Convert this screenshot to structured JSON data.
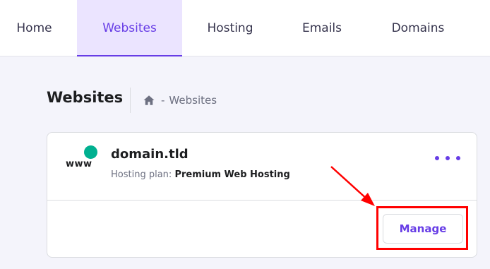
{
  "nav": {
    "tabs": [
      {
        "label": "Home",
        "active": false
      },
      {
        "label": "Websites",
        "active": true
      },
      {
        "label": "Hosting",
        "active": false
      },
      {
        "label": "Emails",
        "active": false
      },
      {
        "label": "Domains",
        "active": false
      }
    ]
  },
  "header": {
    "title": "Websites",
    "breadcrumb": {
      "separator": "-",
      "current": "Websites",
      "home_icon": "home-icon"
    }
  },
  "website_card": {
    "icon_text": "www",
    "domain": "domain.tld",
    "plan_label": "Hosting plan:",
    "plan_value": "Premium Web Hosting",
    "more_icon": "more-horizontal-icon",
    "manage_label": "Manage"
  },
  "colors": {
    "accent": "#673de6",
    "active_tab_bg": "#ebe4ff",
    "status_dot": "#00b090",
    "annotation": "#ff0000",
    "page_bg": "#f4f4fb"
  }
}
